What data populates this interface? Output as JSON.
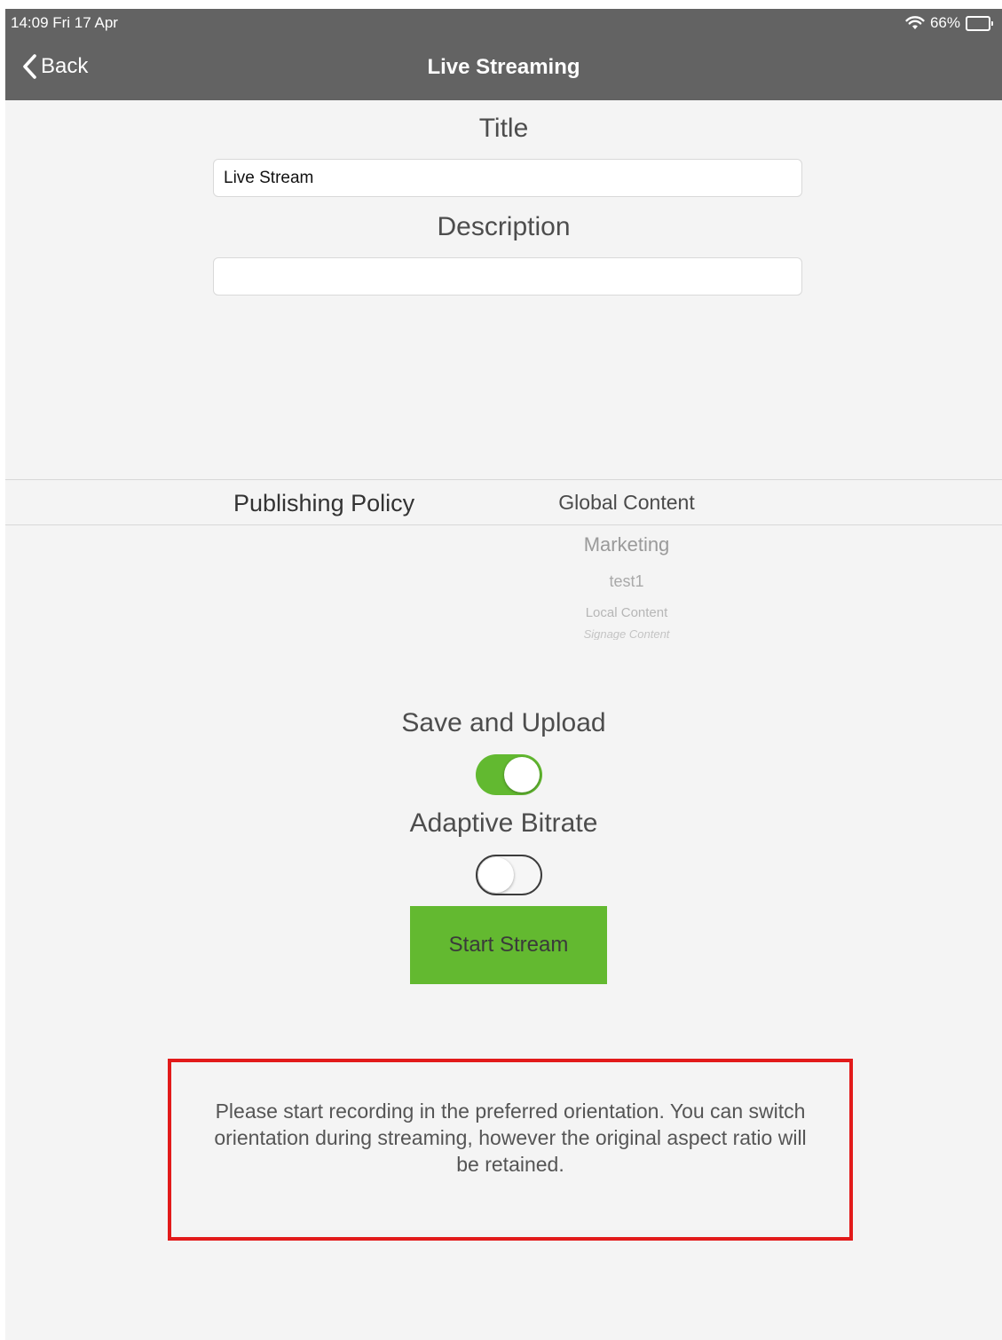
{
  "status_bar": {
    "time_date": "14:09  Fri 17 Apr",
    "battery": "66%",
    "battery_level": 0.66,
    "wifi_icon": "wifi-icon",
    "battery_icon": "battery-icon"
  },
  "nav": {
    "back_label": "Back",
    "back_icon": "chevron-left-icon",
    "title": "Live Streaming"
  },
  "form": {
    "title_label": "Title",
    "title_value": "Live Stream",
    "description_label": "Description",
    "description_value": ""
  },
  "policy": {
    "label": "Publishing Policy",
    "options": [
      "Global Content",
      "Marketing",
      "test1",
      "Local Content",
      "Signage Content"
    ]
  },
  "toggles": {
    "save_upload_label": "Save and Upload",
    "save_upload_on": true,
    "adaptive_bitrate_label": "Adaptive Bitrate",
    "adaptive_bitrate_on": false
  },
  "start_button": "Start Stream",
  "notice": "Please start recording in the preferred orientation. You can switch orientation during streaming, however the original aspect ratio will be retained.",
  "colors": {
    "navbar": "#636363",
    "accent_green": "#63b930",
    "notice_border": "#e21a1a",
    "background": "#f4f4f4"
  }
}
